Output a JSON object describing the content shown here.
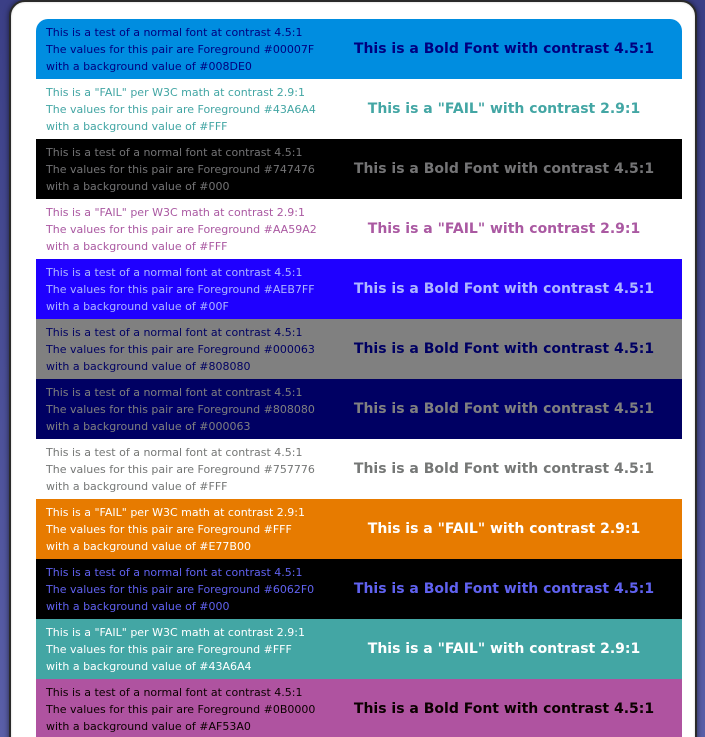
{
  "rows": [
    {
      "fg": "#00007F",
      "bg": "#008DE0",
      "line1": "This is a test of a normal font at contrast 4.5:1",
      "line2": "The values for this pair are Foreground #00007F",
      "line3": "with a background value of #008DE0",
      "bold": "This is a Bold Font with contrast 4.5:1"
    },
    {
      "fg": "#43A6A4",
      "bg": "#FFFFFF",
      "line1": "This is a \"FAIL\" per W3C math at contrast 2.9:1",
      "line2": "The values for this pair are Foreground #43A6A4",
      "line3": "with a background value of #FFF",
      "bold": "This is a \"FAIL\" with contrast 2.9:1"
    },
    {
      "fg": "#747476",
      "bg": "#000000",
      "line1": "This is a test of a normal font at contrast 4.5:1",
      "line2": "The values for this pair are Foreground #747476",
      "line3": "with a background value of #000",
      "bold": "This is a Bold Font with contrast 4.5:1"
    },
    {
      "fg": "#AA59A2",
      "bg": "#FFFFFF",
      "line1": "This is a \"FAIL\" per W3C math at contrast 2.9:1",
      "line2": "The values for this pair are Foreground #AA59A2",
      "line3": "with a background value of #FFF",
      "bold": "This is a \"FAIL\" with contrast 2.9:1"
    },
    {
      "fg": "#AEB7FF",
      "bg": "#1F00FF",
      "line1": "This is a test of a normal font at contrast 4.5:1",
      "line2": "The values for this pair are Foreground #AEB7FF",
      "line3": "with a background value of #00F",
      "bold": "This is a Bold Font with contrast 4.5:1"
    },
    {
      "fg": "#000063",
      "bg": "#808080",
      "line1": "This is a test of a normal font at contrast 4.5:1",
      "line2": "The values for this pair are Foreground #000063",
      "line3": "with a background value of #808080",
      "bold": "This is a Bold Font with contrast 4.5:1"
    },
    {
      "fg": "#808080",
      "bg": "#000063",
      "line1": "This is a test of a normal font at contrast 4.5:1",
      "line2": "The values for this pair are Foreground #808080",
      "line3": "with a background value of #000063",
      "bold": "This is a Bold Font with contrast 4.5:1"
    },
    {
      "fg": "#757776",
      "bg": "#FFFFFF",
      "line1": "This is a test of a normal font at contrast 4.5:1",
      "line2": "The values for this pair are Foreground #757776",
      "line3": "with a background value of #FFF",
      "bold": "This is a Bold Font with contrast 4.5:1"
    },
    {
      "fg": "#FFFFFF",
      "bg": "#E77B00",
      "line1": "This is a \"FAIL\" per W3C math at contrast 2.9:1",
      "line2": "The values for this pair are Foreground #FFF",
      "line3": "with a background value of #E77B00",
      "bold": "This is a \"FAIL\" with contrast 2.9:1"
    },
    {
      "fg": "#6062F0",
      "bg": "#000000",
      "line1": "This is a test of a normal font at contrast 4.5:1",
      "line2": "The values for this pair are Foreground #6062F0",
      "line3": "with a background value of #000",
      "bold": "This is a Bold Font with contrast 4.5:1"
    },
    {
      "fg": "#FFFFFF",
      "bg": "#43A6A4",
      "line1": "This is a \"FAIL\" per W3C math at contrast 2.9:1",
      "line2": "The values for this pair are Foreground #FFF",
      "line3": "with a background value of #43A6A4",
      "bold": "This is a \"FAIL\" with contrast 2.9:1"
    },
    {
      "fg": "#0B0000",
      "bg": "#AF53A0",
      "line1": "This is a test of a normal font at contrast 4.5:1",
      "line2": "The values for this pair are Foreground #0B0000",
      "line3": "with a background value of #AF53A0",
      "bold": "This is a Bold Font with contrast 4.5:1"
    }
  ]
}
